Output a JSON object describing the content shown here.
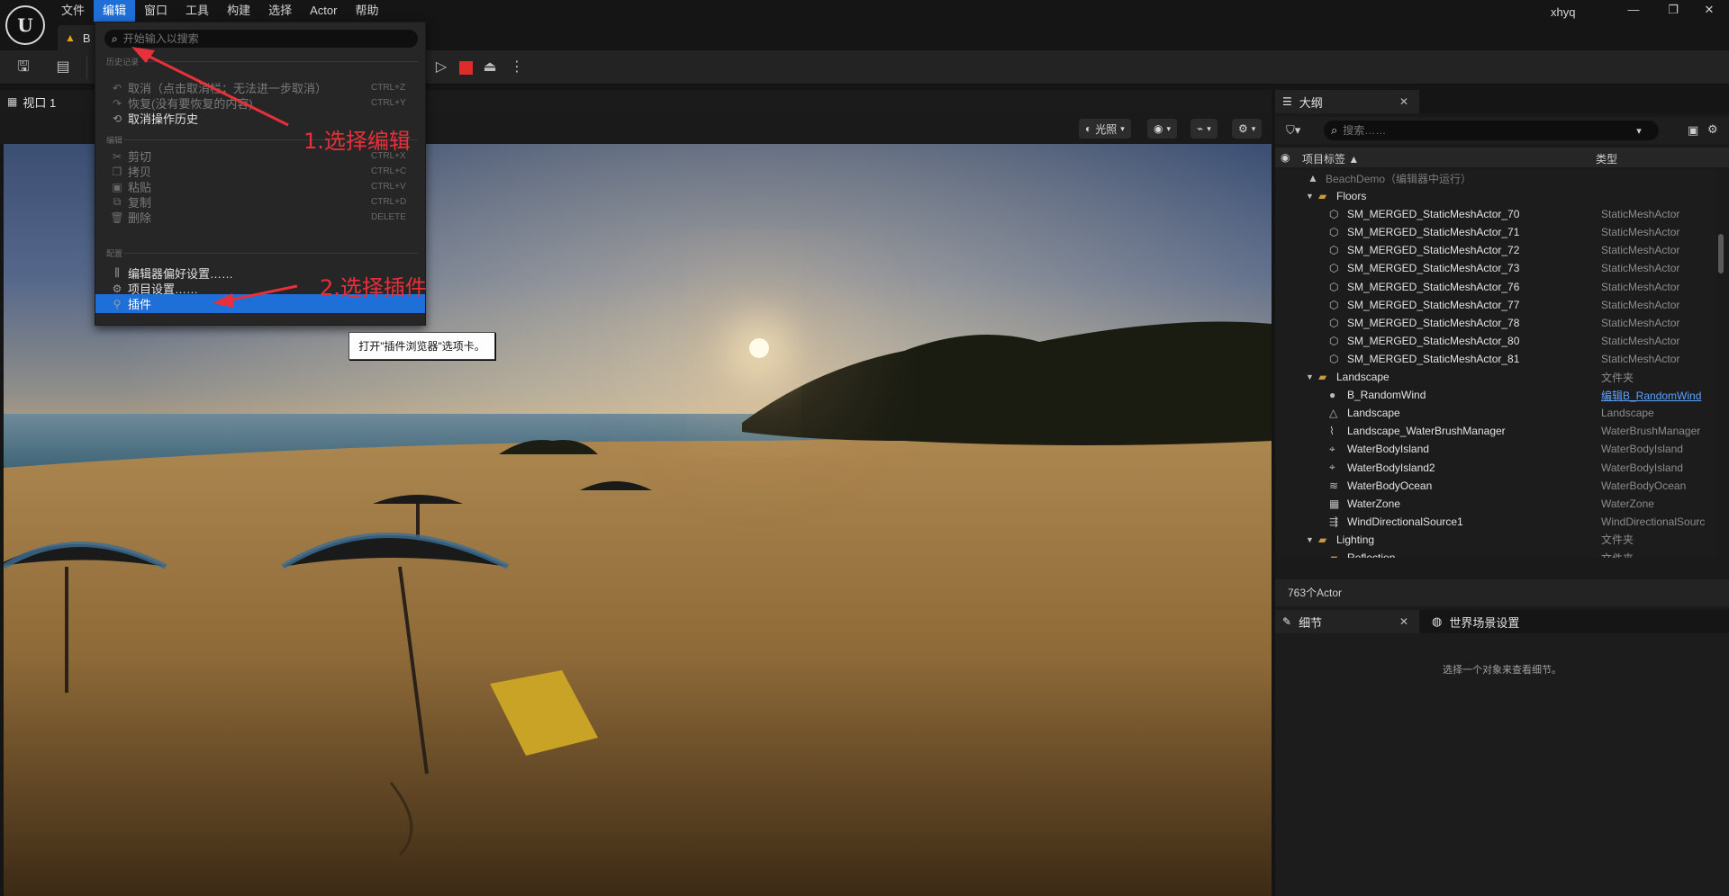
{
  "app": {
    "user": "xhyq",
    "menus": [
      "文件",
      "编辑",
      "窗口",
      "工具",
      "构建",
      "选择",
      "Actor",
      "帮助"
    ],
    "document_tab": "B"
  },
  "viewport": {
    "tab_label": "视口 1",
    "lighting_label": "光照"
  },
  "edit_menu": {
    "search_placeholder": "开始输入以搜索",
    "sections": {
      "history": "历史记录",
      "edit": "编辑",
      "config": "配置"
    },
    "items": [
      {
        "label": "取消（点击取消栏；无法进一步取消）",
        "shortcut": "CTRL+Z",
        "icon": "undo-icon"
      },
      {
        "label": "恢复(没有要恢复的内容)",
        "shortcut": "CTRL+Y",
        "icon": "redo-icon"
      },
      {
        "label": "取消操作历史",
        "shortcut": "",
        "icon": "history-icon"
      },
      {
        "label": "剪切",
        "shortcut": "CTRL+X",
        "icon": "cut-icon"
      },
      {
        "label": "拷贝",
        "shortcut": "CTRL+C",
        "icon": "copy-icon"
      },
      {
        "label": "粘贴",
        "shortcut": "CTRL+V",
        "icon": "paste-icon"
      },
      {
        "label": "复制",
        "shortcut": "CTRL+D",
        "icon": "duplicate-icon"
      },
      {
        "label": "删除",
        "shortcut": "DELETE",
        "icon": "delete-icon"
      },
      {
        "label": "编辑器偏好设置……",
        "shortcut": "",
        "icon": "sliders-icon"
      },
      {
        "label": "项目设置……",
        "shortcut": "",
        "icon": "settings-icon"
      },
      {
        "label": "插件",
        "shortcut": "",
        "icon": "plugin-icon"
      }
    ]
  },
  "tooltip": "打开\"插件浏览器\"选项卡。",
  "annotations": {
    "step1": "1.选择编辑",
    "step2": "2.选择插件",
    "color": "#e8303a"
  },
  "outliner": {
    "tab_label": "大纲",
    "search_placeholder": "搜索……",
    "col_label": "项目标签 ▲",
    "col_type": "类型",
    "rows": [
      {
        "name": "BeachDemo（编辑器中运行）",
        "type": "",
        "icon": "level-icon",
        "indent": 0,
        "dim": true
      },
      {
        "name": "Floors",
        "type": "",
        "icon": "folder-open-icon",
        "indent": 1
      },
      {
        "name": "SM_MERGED_StaticMeshActor_70",
        "type": "StaticMeshActor",
        "icon": "mesh-icon",
        "indent": 2
      },
      {
        "name": "SM_MERGED_StaticMeshActor_71",
        "type": "StaticMeshActor",
        "icon": "mesh-icon",
        "indent": 2
      },
      {
        "name": "SM_MERGED_StaticMeshActor_72",
        "type": "StaticMeshActor",
        "icon": "mesh-icon",
        "indent": 2
      },
      {
        "name": "SM_MERGED_StaticMeshActor_73",
        "type": "StaticMeshActor",
        "icon": "mesh-icon",
        "indent": 2
      },
      {
        "name": "SM_MERGED_StaticMeshActor_76",
        "type": "StaticMeshActor",
        "icon": "mesh-icon",
        "indent": 2
      },
      {
        "name": "SM_MERGED_StaticMeshActor_77",
        "type": "StaticMeshActor",
        "icon": "mesh-icon",
        "indent": 2
      },
      {
        "name": "SM_MERGED_StaticMeshActor_78",
        "type": "StaticMeshActor",
        "icon": "mesh-icon",
        "indent": 2
      },
      {
        "name": "SM_MERGED_StaticMeshActor_80",
        "type": "StaticMeshActor",
        "icon": "mesh-icon",
        "indent": 2
      },
      {
        "name": "SM_MERGED_StaticMeshActor_81",
        "type": "StaticMeshActor",
        "icon": "mesh-icon",
        "indent": 2
      },
      {
        "name": "Landscape",
        "type": "文件夹",
        "icon": "folder-open-icon",
        "indent": 1
      },
      {
        "name": "B_RandomWind",
        "type": "编辑B_RandomWind",
        "icon": "actor-icon",
        "indent": 2,
        "link": true
      },
      {
        "name": "Landscape",
        "type": "Landscape",
        "icon": "landscape-icon",
        "indent": 2
      },
      {
        "name": "Landscape_WaterBrushManager",
        "type": "WaterBrushManager",
        "icon": "brush-icon",
        "indent": 2
      },
      {
        "name": "WaterBodyIsland",
        "type": "WaterBodyIsland",
        "icon": "water-icon",
        "indent": 2
      },
      {
        "name": "WaterBodyIsland2",
        "type": "WaterBodyIsland",
        "icon": "water-icon",
        "indent": 2
      },
      {
        "name": "WaterBodyOcean",
        "type": "WaterBodyOcean",
        "icon": "wave-icon",
        "indent": 2
      },
      {
        "name": "WaterZone",
        "type": "WaterZone",
        "icon": "zone-icon",
        "indent": 2
      },
      {
        "name": "WindDirectionalSource1",
        "type": "WindDirectionalSourc",
        "icon": "wind-icon",
        "indent": 2
      },
      {
        "name": "Lighting",
        "type": "文件夹",
        "icon": "folder-open-icon",
        "indent": 1
      },
      {
        "name": "Reflection",
        "type": "文件夹",
        "icon": "folder-open-icon",
        "indent": 2
      }
    ],
    "actor_count": "763个Actor"
  },
  "details": {
    "tab_details": "细节",
    "tab_world": "世界场景设置",
    "empty_msg": "选择一个对象来查看细节。"
  }
}
